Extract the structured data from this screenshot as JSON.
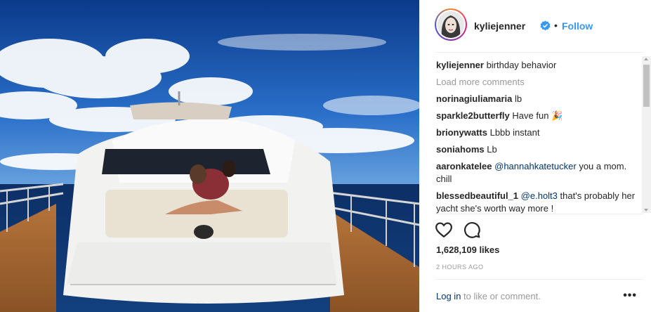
{
  "post": {
    "username": "kyliejenner",
    "follow_label": "Follow",
    "separator": "•",
    "verified_icon": "verified-badge-icon",
    "caption": {
      "user": "kyliejenner",
      "text": "birthday behavior"
    },
    "load_more": "Load more comments",
    "comments": [
      {
        "user": "norinagiuliamaria",
        "text": "lb"
      },
      {
        "user": "sparkle2butterfly",
        "text": "Have fun 🎉"
      },
      {
        "user": "brionywatts",
        "text": "Lbbb instant"
      },
      {
        "user": "soniahoms",
        "text": "Lb"
      },
      {
        "user": "aaronkatelee",
        "mention": "@hannahkatetucker",
        "text": "you a mom. chill"
      },
      {
        "user": "blessedbeautiful_1",
        "mention": "@e.holt3",
        "text": "that's probably her yacht she's worth way more !"
      }
    ],
    "likes": "1,628,109 likes",
    "time": "2 HOURS AGO",
    "login_link": "Log in",
    "login_rest": "to like or comment.",
    "more_label": "•••"
  },
  "colors": {
    "link_blue": "#3897f0",
    "mention_blue": "#003569",
    "muted": "#999999"
  }
}
